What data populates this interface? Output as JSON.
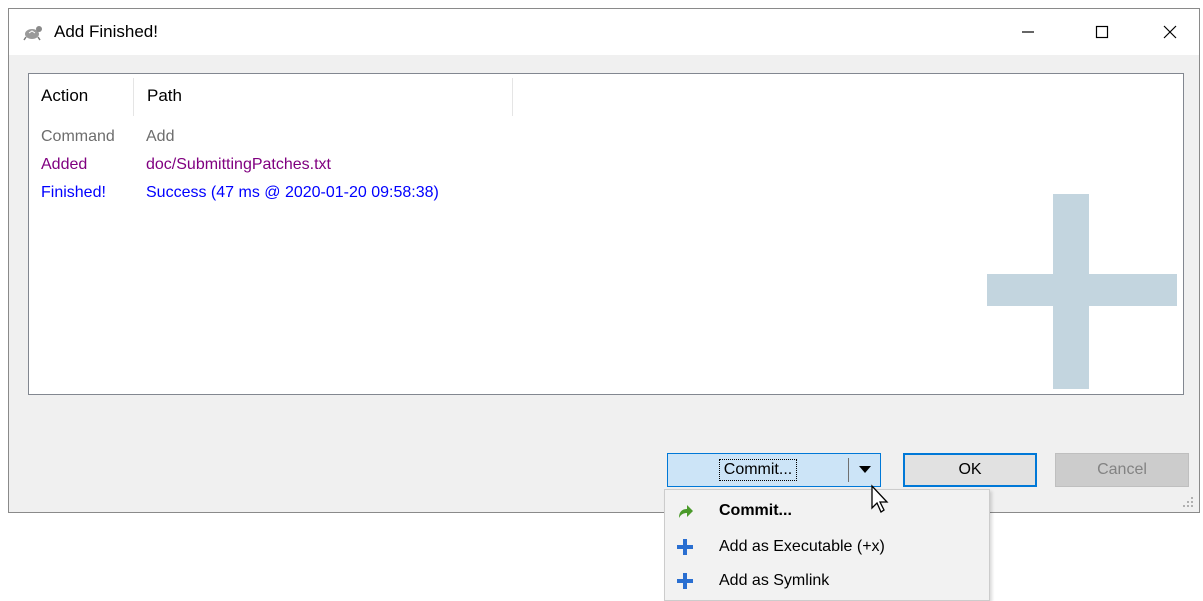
{
  "window": {
    "title": "Add Finished!"
  },
  "list": {
    "columns": [
      "Action",
      "Path"
    ],
    "rows": [
      {
        "action": "Command",
        "path": "Add",
        "color": "#6d6d6d"
      },
      {
        "action": "Added",
        "path": "doc/SubmittingPatches.txt",
        "color": "#800080"
      },
      {
        "action": "Finished!",
        "path": "Success (47 ms @ 2020-01-20 09:58:38)",
        "color": "#0000ff"
      }
    ]
  },
  "buttons": {
    "commit_label": "Commit...",
    "ok_label": "OK",
    "cancel_label": "Cancel"
  },
  "menu": {
    "items": [
      {
        "label": "Commit...",
        "icon": "green-arrow-icon"
      },
      {
        "label": "Add as Executable (+x)",
        "icon": "plus-icon"
      },
      {
        "label": "Add as Symlink",
        "icon": "plus-icon"
      }
    ]
  },
  "colors": {
    "accent": "#0078d7",
    "watermark": "#c3d5df",
    "menu_plus": "#2a6fd1",
    "commit_arrow": "#4a9a2a"
  }
}
